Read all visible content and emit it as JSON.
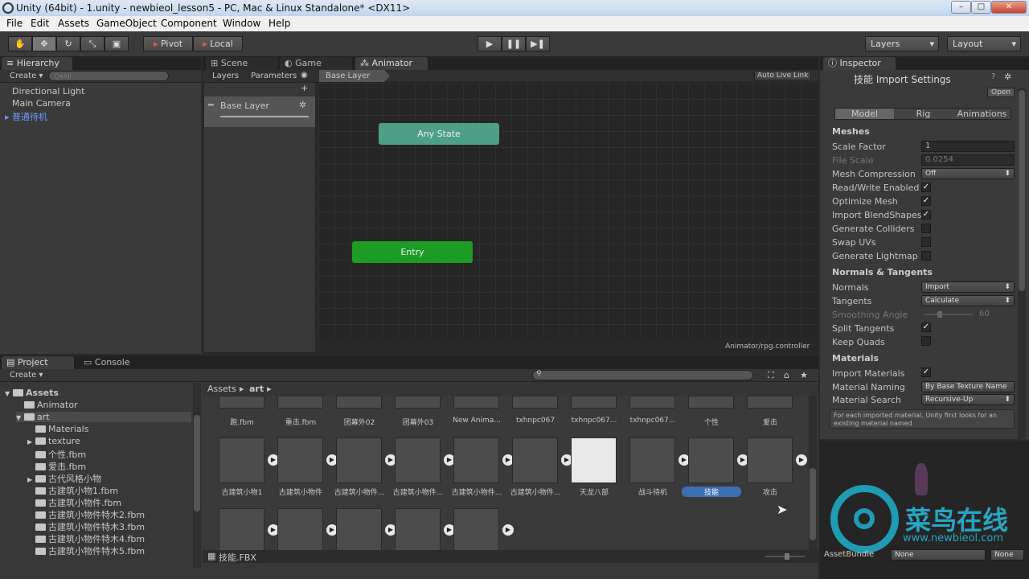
{
  "window": {
    "title": "Unity (64bit) - 1.unity - newbieol_lesson5 - PC, Mac & Linux Standalone* <DX11>",
    "minimize": "–",
    "maximize": "□",
    "close": "✕"
  },
  "menu": [
    "File",
    "Edit",
    "Assets",
    "GameObject",
    "Component",
    "Window",
    "Help"
  ],
  "toolbar": {
    "pivot": "Pivot",
    "local": "Local",
    "layers": "Layers",
    "layout": "Layout"
  },
  "hierarchy": {
    "tab": "Hierarchy",
    "create": "Create ▾",
    "search_placeholder": "Q▾All",
    "items": [
      "Directional Light",
      "Main Camera",
      "普通待机"
    ]
  },
  "center_tabs": [
    "Scene",
    "Game",
    "Animator"
  ],
  "animator": {
    "tab_layers": "Layers",
    "tab_parameters": "Parameters",
    "breadcrumb": "Base Layer",
    "auto_live_link": "Auto Live Link",
    "layer_name": "Base Layer",
    "plus": "+",
    "node_any_state": "Any State",
    "node_entry": "Entry",
    "footer_path": "Animator/rpg.controller"
  },
  "inspector": {
    "tab": "Inspector",
    "title": "技能 Import Settings",
    "open": "Open",
    "tabs": [
      "Model",
      "Rig",
      "Animations"
    ],
    "section_meshes": "Meshes",
    "scale_factor_label": "Scale Factor",
    "scale_factor_value": "1",
    "file_scale_label": "File Scale",
    "file_scale_value": "0.0254",
    "mesh_compression_label": "Mesh Compression",
    "mesh_compression_value": "Off",
    "read_write_label": "Read/Write Enabled",
    "optimize_mesh_label": "Optimize Mesh",
    "import_blend_label": "Import BlendShapes",
    "gen_colliders_label": "Generate Colliders",
    "swap_uvs_label": "Swap UVs",
    "gen_lightmap_label": "Generate Lightmap U",
    "section_normals": "Normals & Tangents",
    "normals_label": "Normals",
    "normals_value": "Import",
    "tangents_label": "Tangents",
    "tangents_value": "Calculate",
    "smoothing_label": "Smoothing Angle",
    "smoothing_value": "60",
    "split_tangents_label": "Split Tangents",
    "keep_quads_label": "Keep Quads",
    "section_materials": "Materials",
    "import_materials_label": "Import Materials",
    "material_naming_label": "Material Naming",
    "material_naming_value": "By Base Texture Name",
    "material_search_label": "Material Search",
    "material_search_value": "Recursive-Up",
    "help_text": "For each imported material, Unity first looks for an existing material named",
    "check": "✓",
    "assetbundle_label": "AssetBundle",
    "assetbundle_value": "None",
    "assetbundle_variant": "None"
  },
  "project": {
    "tab_project": "Project",
    "tab_console": "Console",
    "create": "Create ▾",
    "breadcrumb_root": "Assets",
    "breadcrumb_child": "art",
    "tree": [
      {
        "label": "Assets",
        "indent": 0,
        "arrow": "▼"
      },
      {
        "label": "Animator",
        "indent": 1,
        "arrow": ""
      },
      {
        "label": "art",
        "indent": 1,
        "arrow": "▼"
      },
      {
        "label": "Materials",
        "indent": 2,
        "arrow": ""
      },
      {
        "label": "texture",
        "indent": 2,
        "arrow": "▶"
      },
      {
        "label": "个性.fbm",
        "indent": 2,
        "arrow": ""
      },
      {
        "label": "爱击.fbm",
        "indent": 2,
        "arrow": ""
      },
      {
        "label": "古代风格小物",
        "indent": 2,
        "arrow": "▶"
      },
      {
        "label": "古建筑小物1.fbm",
        "indent": 2,
        "arrow": ""
      },
      {
        "label": "古建筑小物件.fbm",
        "indent": 2,
        "arrow": ""
      },
      {
        "label": "古建筑小物件特木2.fbm",
        "indent": 2,
        "arrow": ""
      },
      {
        "label": "古建筑小物件特木3.fbm",
        "indent": 2,
        "arrow": ""
      },
      {
        "label": "古建筑小物件特木4.fbm",
        "indent": 2,
        "arrow": ""
      },
      {
        "label": "古建筑小物件特木5.fbm",
        "indent": 2,
        "arrow": ""
      }
    ],
    "row1": [
      "跑.fbm",
      "重击.fbm",
      "团幕外02",
      "团幕外03",
      "New Anima...",
      "txhnpc067",
      "txhnpc067...",
      "txhnpc067...",
      "个性",
      "爱击"
    ],
    "row2": [
      "古建筑小物1",
      "古建筑小物件",
      "古建筑小物件...",
      "古建筑小物件...",
      "古建筑小物件...",
      "古建筑小物件...",
      "天龙八部",
      "战斗待机",
      "技能",
      "攻击"
    ],
    "row3_count_label": "",
    "selected_file": "技能.FBX"
  },
  "watermark": {
    "brand": "菜鸟在线",
    "url": "www.newbieol.com"
  }
}
